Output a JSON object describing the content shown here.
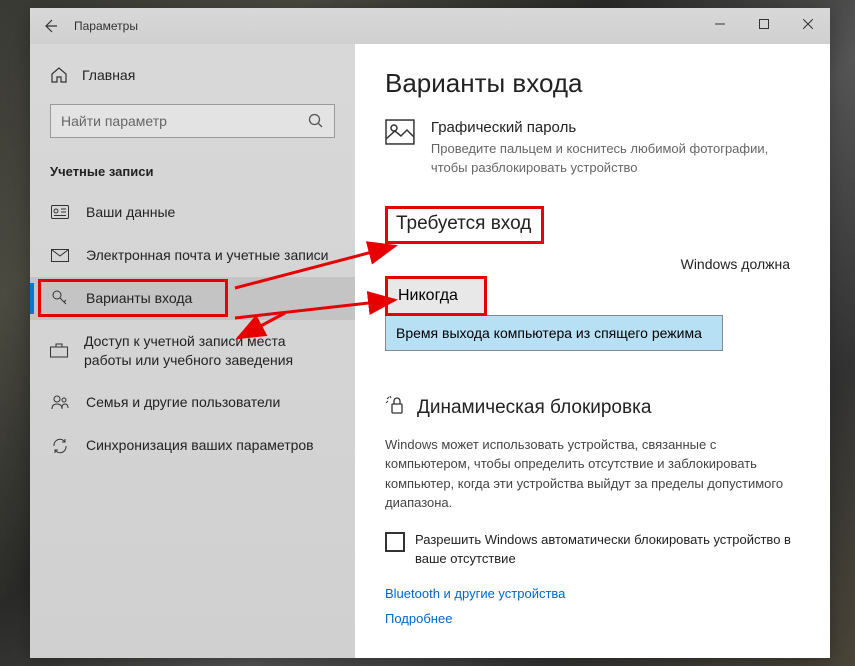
{
  "window": {
    "title": "Параметры"
  },
  "sidebar": {
    "home": "Главная",
    "search_placeholder": "Найти параметр",
    "category": "Учетные записи",
    "items": [
      {
        "label": "Ваши данные"
      },
      {
        "label": "Электронная почта и учетные записи"
      },
      {
        "label": "Варианты входа"
      },
      {
        "label": "Доступ к учетной записи места работы или учебного заведения"
      },
      {
        "label": "Семья и другие пользователи"
      },
      {
        "label": "Синхронизация ваших параметров"
      }
    ]
  },
  "content": {
    "title": "Варианты входа",
    "picture_password": {
      "title": "Графический пароль",
      "desc": "Проведите пальцем и коснитесь любимой фотографии, чтобы разблокировать устройство"
    },
    "require_signin": {
      "heading": "Требуется вход",
      "question_tail": "Windows должна",
      "options": [
        "Никогда",
        "Время выхода компьютера из спящего режима"
      ]
    },
    "dynamic_lock": {
      "heading": "Динамическая блокировка",
      "desc": "Windows может использовать устройства, связанные с компьютером, чтобы определить отсутствие и заблокировать компьютер, когда эти устройства выйдут за пределы допустимого диапазона.",
      "checkbox": "Разрешить Windows автоматически блокировать устройство в ваше отсутствие",
      "link1": "Bluetooth и другие устройства",
      "link2": "Подробнее"
    }
  }
}
